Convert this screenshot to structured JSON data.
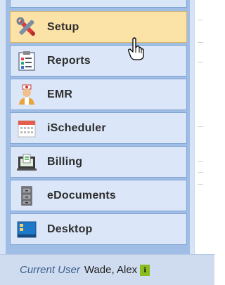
{
  "nav": {
    "items": [
      {
        "label": "Setup",
        "icon": "tools-icon",
        "active": true
      },
      {
        "label": "Reports",
        "icon": "reports-icon",
        "active": false
      },
      {
        "label": "EMR",
        "icon": "doctor-icon",
        "active": false
      },
      {
        "label": "iScheduler",
        "icon": "calendar-icon",
        "active": false
      },
      {
        "label": "Billing",
        "icon": "billing-icon",
        "active": false
      },
      {
        "label": "eDocuments",
        "icon": "cabinet-icon",
        "active": false
      },
      {
        "label": "Desktop",
        "icon": "desktop-icon",
        "active": false
      }
    ]
  },
  "footer": {
    "label": "Current User",
    "user": "Wade, Alex",
    "info_icon": "i"
  },
  "colors": {
    "panel": "#9fbde5",
    "item_bg": "#dbe7f8",
    "active_bg": "#fbe3a7",
    "info_badge": "#8bbd20"
  }
}
